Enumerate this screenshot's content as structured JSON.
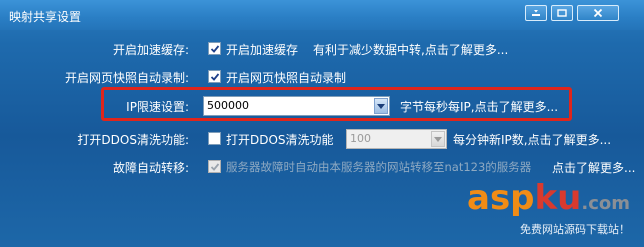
{
  "window": {
    "title": "映射共享设置",
    "minimize_icon": "minimize-icon",
    "close_icon": "close-icon"
  },
  "rows": {
    "speedup": {
      "label": "开启加速缓存:",
      "checkbox_label": "开启加速缓存",
      "checked": true,
      "hint": "有利于减少数据中转,点击了解更多..."
    },
    "snapshot": {
      "label": "开启网页快照自动录制:",
      "checkbox_label": "开启网页快照自动录制",
      "checked": true
    },
    "iplimit": {
      "label": "IP限速设置:",
      "value": "500000",
      "hint": "字节每秒每IP,点击了解更多..."
    },
    "ddos": {
      "label": "打开DDOS清洗功能:",
      "checkbox_label": "打开DDOS清洗功能",
      "checked": false,
      "value": "100",
      "hint": "每分钟新IP数,点击了解更多..."
    },
    "failover": {
      "label": "故障自动转移:",
      "checkbox_label": "服务器故障时自动由本服务器的网站转移至nat123的服务器",
      "checked": true,
      "hint": "点击了解更多..."
    }
  },
  "watermark": {
    "part1": "asp",
    "part2": "ku",
    "part3": ".com",
    "subtitle": "免费网站源码下载站！"
  },
  "colors": {
    "highlight": "#e0251b",
    "background": "#1d67a8"
  }
}
